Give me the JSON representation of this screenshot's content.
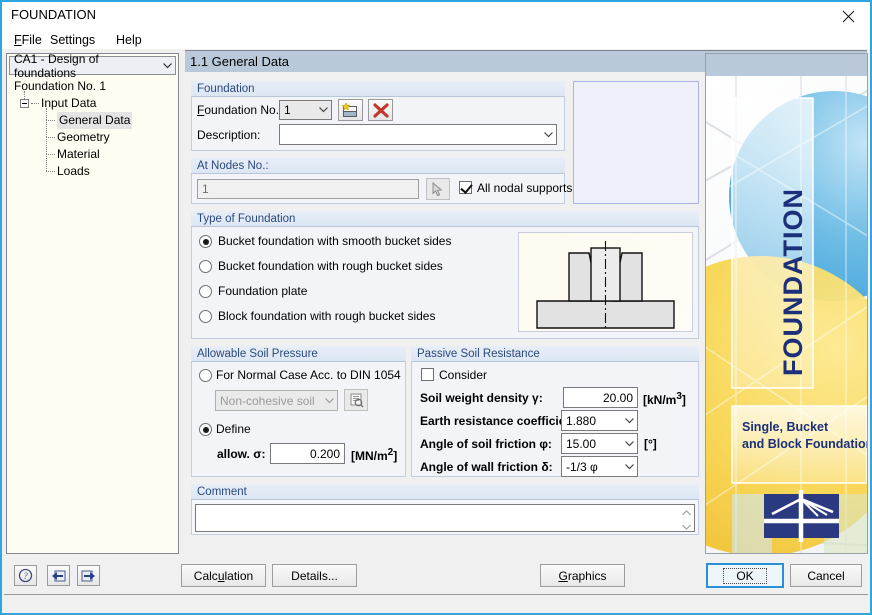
{
  "window": {
    "title": "FOUNDATION",
    "close_icon": "close-icon"
  },
  "menu": [
    {
      "label": "File",
      "accel": "F"
    },
    {
      "label": "Settings",
      "accel": "S"
    },
    {
      "label": "Help",
      "accel": "H"
    }
  ],
  "sidebar": {
    "selector_value": "CA1 - Design of foundations",
    "tree": {
      "root_label": "Foundation No. 1",
      "group_label": "Input Data",
      "items": [
        {
          "label": "General Data",
          "selected": true
        },
        {
          "label": "Geometry",
          "selected": false
        },
        {
          "label": "Material",
          "selected": false
        },
        {
          "label": "Loads",
          "selected": false
        }
      ]
    }
  },
  "main": {
    "tab_title": "1.1 General Data",
    "foundation": {
      "group_title": "Foundation",
      "no_label": "Foundation No.:",
      "no_value": "1",
      "new_icon": "new-foundation-icon",
      "delete_icon": "delete-foundation-icon",
      "description_label": "Description:",
      "description_value": "",
      "description_placeholder": ""
    },
    "nodes": {
      "group_title": "At Nodes No.:",
      "value": "1",
      "pick_icon": "pick-node-icon",
      "all_supports_label": "All nodal supports",
      "all_supports_checked": true
    },
    "type_of_foundation": {
      "group_title": "Type of Foundation",
      "options": [
        {
          "label": "Bucket foundation with smooth bucket sides",
          "selected": true
        },
        {
          "label": "Bucket foundation with rough bucket sides",
          "selected": false
        },
        {
          "label": "Foundation plate",
          "selected": false
        },
        {
          "label": "Block foundation with rough bucket sides",
          "selected": false
        }
      ]
    },
    "allowable_soil_pressure": {
      "group_title": "Allowable Soil Pressure",
      "normal_case_label": "For Normal Case Acc. to DIN 1054",
      "normal_case_selected": false,
      "soil_type_value": "Non-cohesive soil",
      "soil_library_icon": "soil-library-icon",
      "define_label": "Define",
      "define_selected": true,
      "sigma_label": "allow. σ:",
      "sigma_value": "0.200",
      "sigma_unit": "[MN/m2]"
    },
    "passive_soil_resistance": {
      "group_title": "Passive Soil Resistance",
      "consider_label": "Consider",
      "consider_checked": false,
      "rows": [
        {
          "label": "Soil weight density γ:",
          "value": "20.00",
          "unit": "[kN/m3]",
          "kind": "text"
        },
        {
          "label": "Earth resistance coefficient κ",
          "value": "1.880",
          "unit": "",
          "kind": "combo"
        },
        {
          "label": "Angle of soil friction φ:",
          "value": "15.00",
          "unit": "[°]",
          "kind": "combo"
        },
        {
          "label": "Angle of wall friction δ:",
          "value": "-1/3 φ",
          "unit": "",
          "kind": "combo"
        }
      ]
    },
    "comment": {
      "group_title": "Comment",
      "value": ""
    }
  },
  "brand": {
    "vertical_title": "FOUNDATION",
    "subtitle_line1": "Single, Bucket",
    "subtitle_line2": "and Block Foundation",
    "logo_icon": "dlubal-logo-icon",
    "colors": {
      "navy": "#1b2f7a",
      "blue_circle": "#49a9dd",
      "yellow_circle": "#f6d24b"
    }
  },
  "footer": {
    "help_icon": "help-icon",
    "prev_icon": "previous-page-icon",
    "next_icon": "next-page-icon",
    "calculation_label": "Calculation",
    "calculation_accel": "u",
    "details_label": "Details...",
    "graphics_label": "Graphics",
    "graphics_accel": "G",
    "ok_label": "OK",
    "cancel_label": "Cancel"
  }
}
